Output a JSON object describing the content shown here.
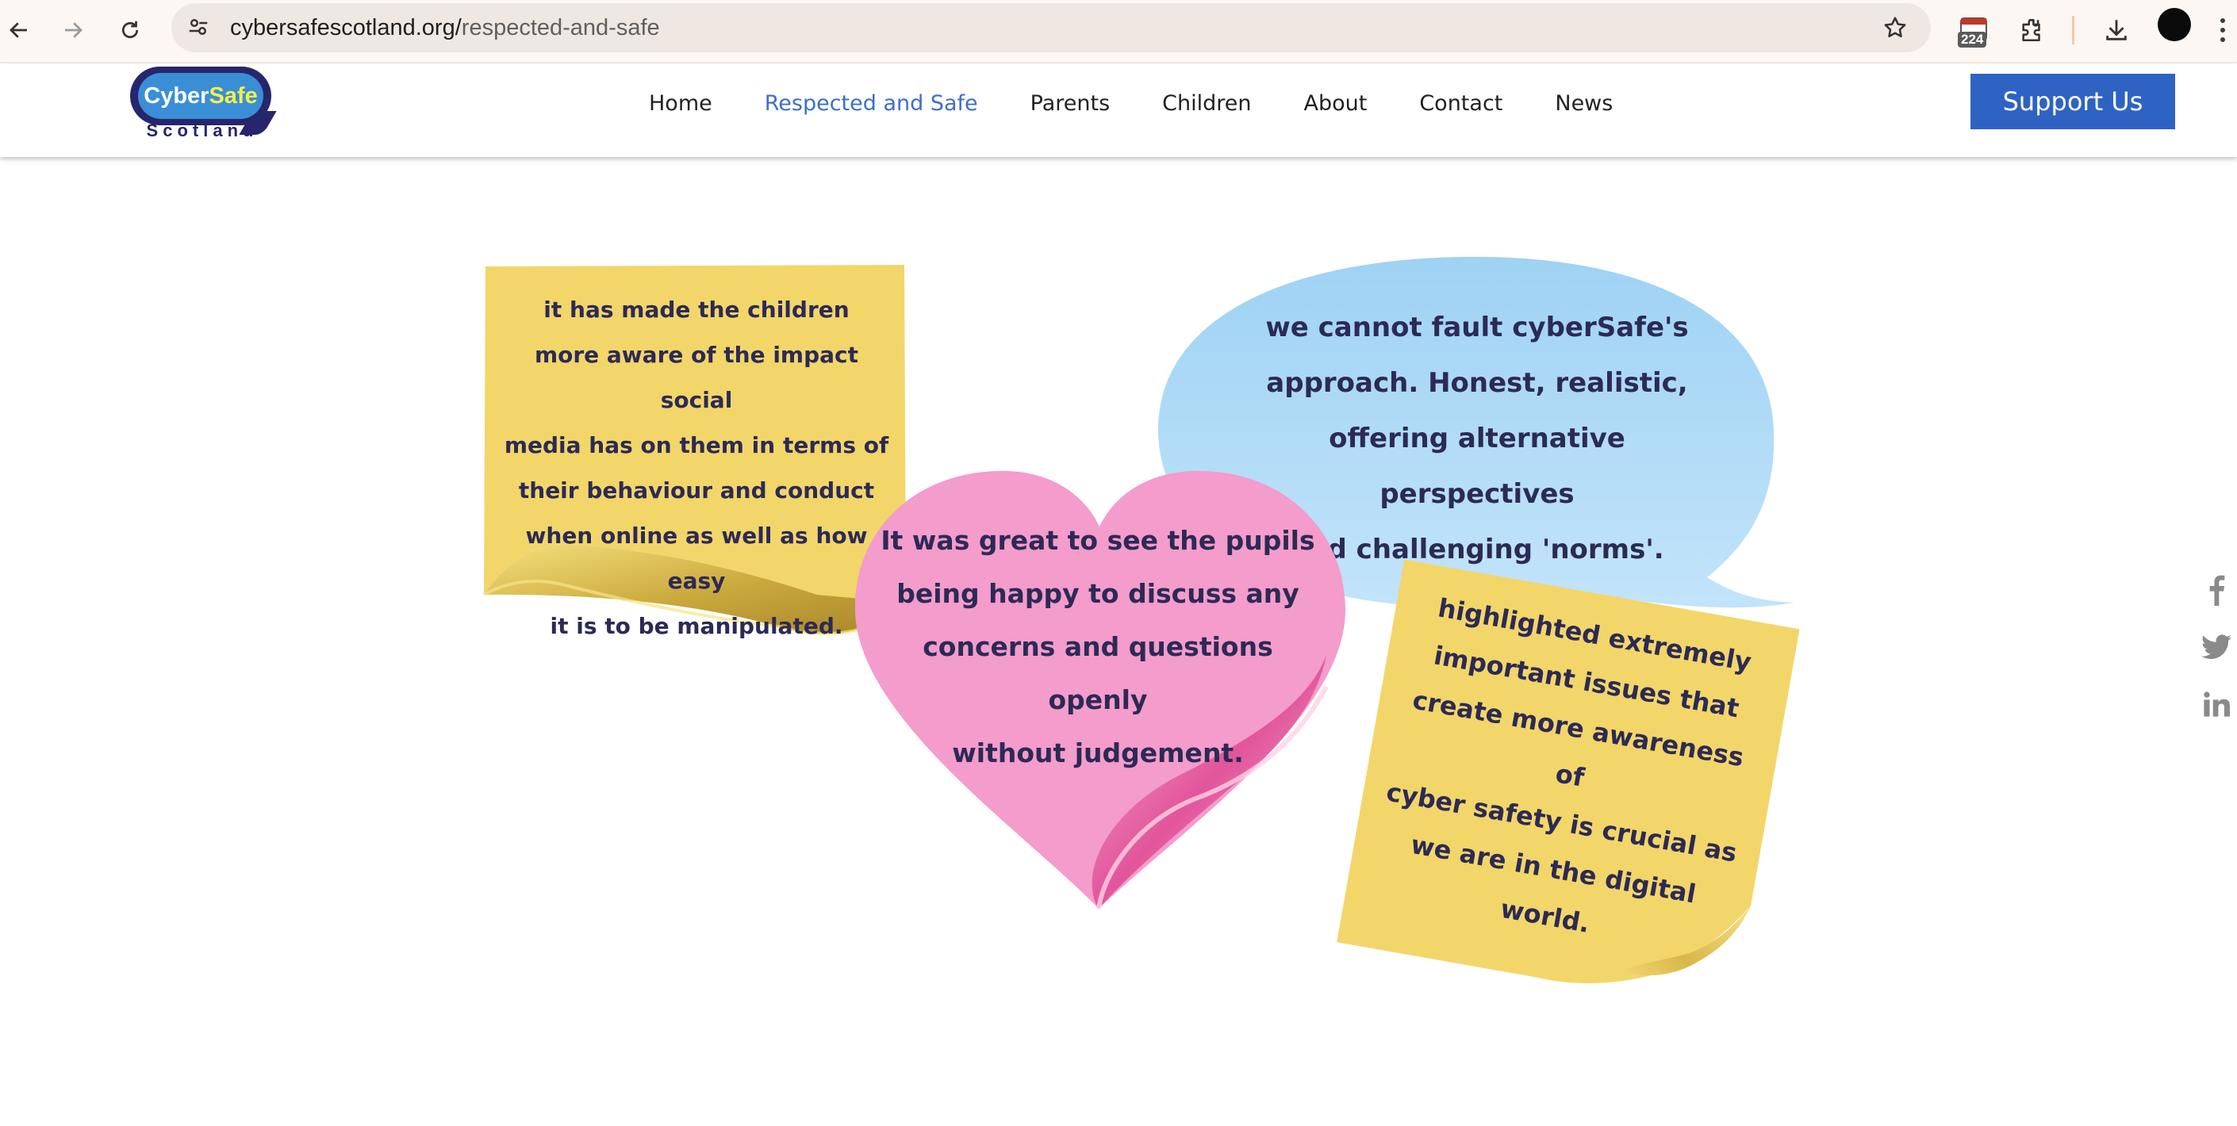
{
  "browser": {
    "url_host": "cybersafescotland.org/",
    "url_path": "respected-and-safe",
    "extension_badge": "224"
  },
  "site": {
    "logo_cyber": "Cyber",
    "logo_safe": "Safe",
    "logo_subtitle": "Scotland",
    "nav": [
      {
        "label": "Home"
      },
      {
        "label": "Respected and Safe",
        "active": true
      },
      {
        "label": "Parents"
      },
      {
        "label": "Children"
      },
      {
        "label": "About"
      },
      {
        "label": "Contact"
      },
      {
        "label": "News"
      }
    ],
    "support_label": "Support Us",
    "accent_color": "#2f63c3",
    "active_nav_color": "#3d6fc4"
  },
  "quotes": {
    "yellow_left": [
      "it has made the children",
      "more aware of the impact social",
      "media has on them in terms of",
      "their behaviour and conduct",
      "when online as well as how easy",
      "it is to be manipulated."
    ],
    "blue_bubble": [
      "we cannot fault cyberSafe's",
      "approach. Honest, realistic,",
      "offering alternative perspectives",
      "and challenging 'norms'."
    ],
    "pink_heart": [
      "It was great to see the pupils",
      "being happy to discuss any",
      "concerns and questions openly",
      "without judgement."
    ],
    "yellow_right": [
      "highlighted extremely",
      "important issues that",
      "create more awareness of",
      "cyber safety is crucial as",
      "we are in the digital world."
    ]
  },
  "social": [
    "facebook-icon",
    "twitter-icon",
    "linkedin-icon"
  ],
  "colors": {
    "sticky_yellow": "#f2d66a",
    "bubble_blue": "#aad8f6",
    "heart_pink": "#f49ccb",
    "quote_text": "#2c2a55"
  }
}
